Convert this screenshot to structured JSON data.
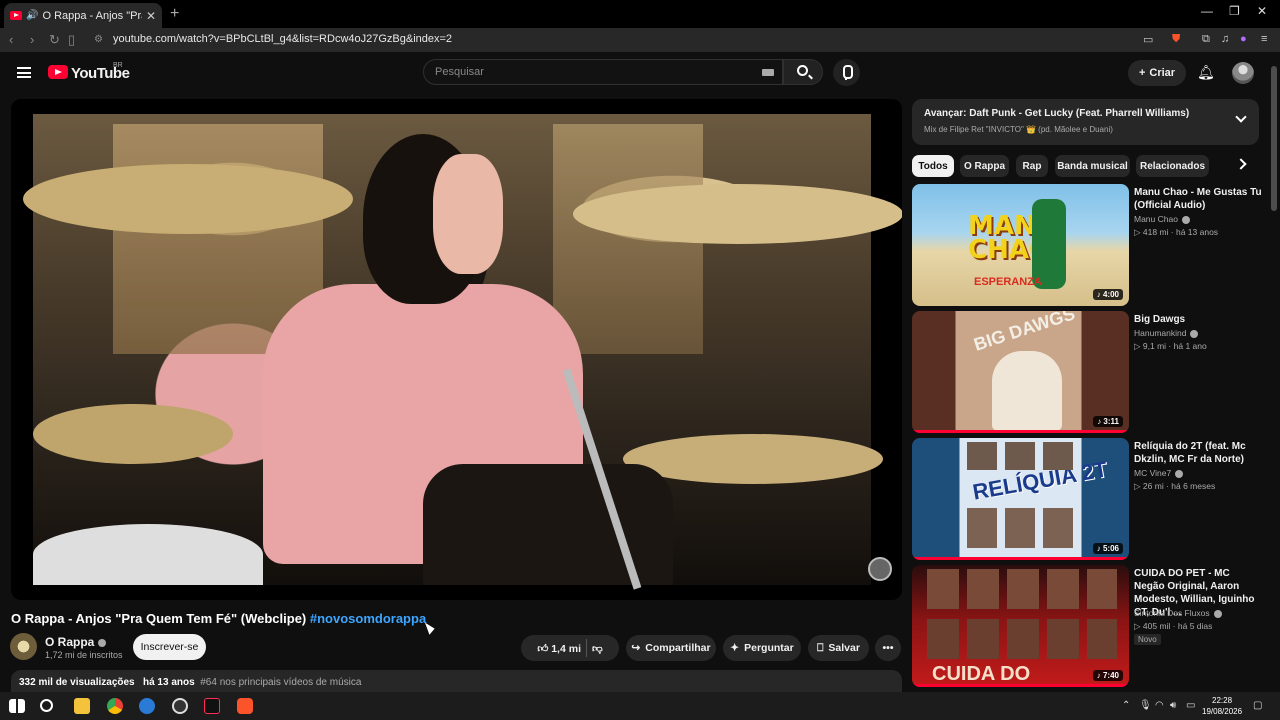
{
  "browser": {
    "tab_title": "O Rappa - Anjos \"Pra Quem Tem Fé\" (Webclipe) - YouTube",
    "url": "youtube.com/watch?v=BPbCLtBl_g4&list=RDcw4oJ27GzBg&index=2"
  },
  "header": {
    "logo_text": "YouTube",
    "country": "BR",
    "search_placeholder": "Pesquisar",
    "create_label": "Criar"
  },
  "video": {
    "title": "O Rappa - Anjos \"Pra Quem Tem Fé\" (Webclipe)",
    "hashtag": "#novosomdorappa",
    "channel": "O Rappa",
    "subscribers": "1,72 mi de inscritos",
    "subscribe_label": "Inscrever-se",
    "likes": "1,4 mi",
    "share_label": "Compartilhar",
    "ask_label": "Perguntar",
    "save_label": "Salvar",
    "views": "332 mil de visualizações",
    "age": "há 13 anos",
    "rank": "#64 nos principais vídeos de música"
  },
  "sidebar": {
    "up_next_prefix": "Avançar:",
    "up_next_title": "Daft Punk - Get Lucky (Feat. Pharrell Williams)",
    "up_next_sub": "Mix de Filipe Ret \"INVICTO\" 👑 (pd. Mãolee e Duani)",
    "chips": [
      "Todos",
      "O Rappa",
      "Rap",
      "Banda musical",
      "Relacionados"
    ],
    "videos": [
      {
        "title": "Manu Chao - Me Gustas Tu (Official Audio)",
        "channel": "Manu Chao",
        "meta": "418 mi · há 13 anos",
        "duration": "4:00",
        "badge": ""
      },
      {
        "title": "Big Dawgs",
        "channel": "Hanumankind",
        "meta": "9,1 mi · há 1 ano",
        "duration": "3:11",
        "badge": ""
      },
      {
        "title": "Relíquia do 2T (feat. Mc Dkzlin, MC Fr da Norte)",
        "channel": "MC Vine7",
        "meta": "26 mi · há 6 meses",
        "duration": "5:06",
        "badge": ""
      },
      {
        "title": "CUIDA DO PET - MC Negão Original, Aaron Modesto, Willian, Iguinho CT, Du'l ...",
        "channel": "Sintonia Dos Fluxos",
        "meta": "405 mil · há 5 dias",
        "duration": "7:40",
        "badge": "Novo"
      }
    ]
  },
  "taskbar": {
    "time": "22:28",
    "date": "19/08/2026"
  }
}
